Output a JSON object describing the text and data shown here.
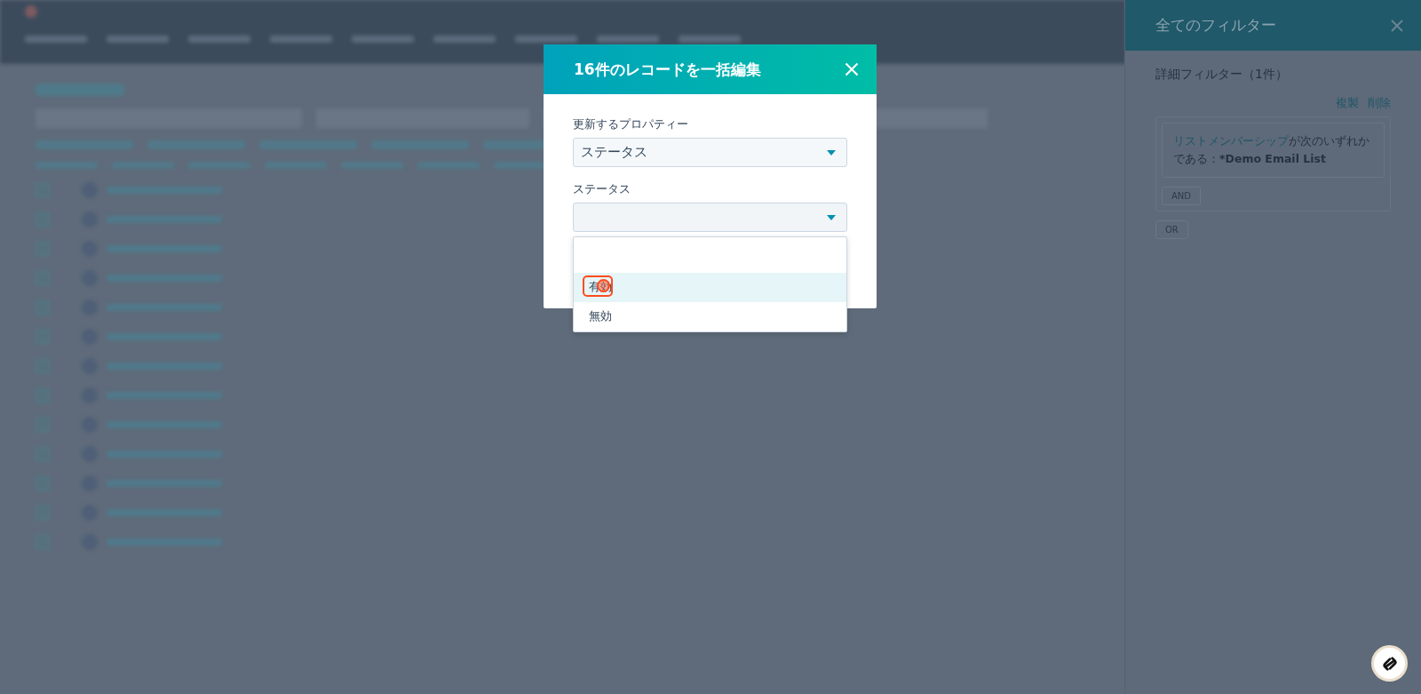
{
  "modal": {
    "title": "16件のレコードを一括編集",
    "fields": [
      {
        "label": "更新するプロパティー",
        "value": "ステータス"
      },
      {
        "label": "ステータス",
        "options": [
          {
            "label": "有効",
            "selected": true
          },
          {
            "label": "無効",
            "selected": false
          }
        ]
      }
    ]
  },
  "filter_panel": {
    "title": "全てのフィルター",
    "section": "詳細フィルター（1件）",
    "actions": [
      "複製",
      "削除"
    ],
    "condition": {
      "property": "リストメンバーシップ",
      "operator": "が次のいずれかである：",
      "value": "*Demo Email List"
    },
    "and_button": "AND",
    "or_button": "OR"
  }
}
